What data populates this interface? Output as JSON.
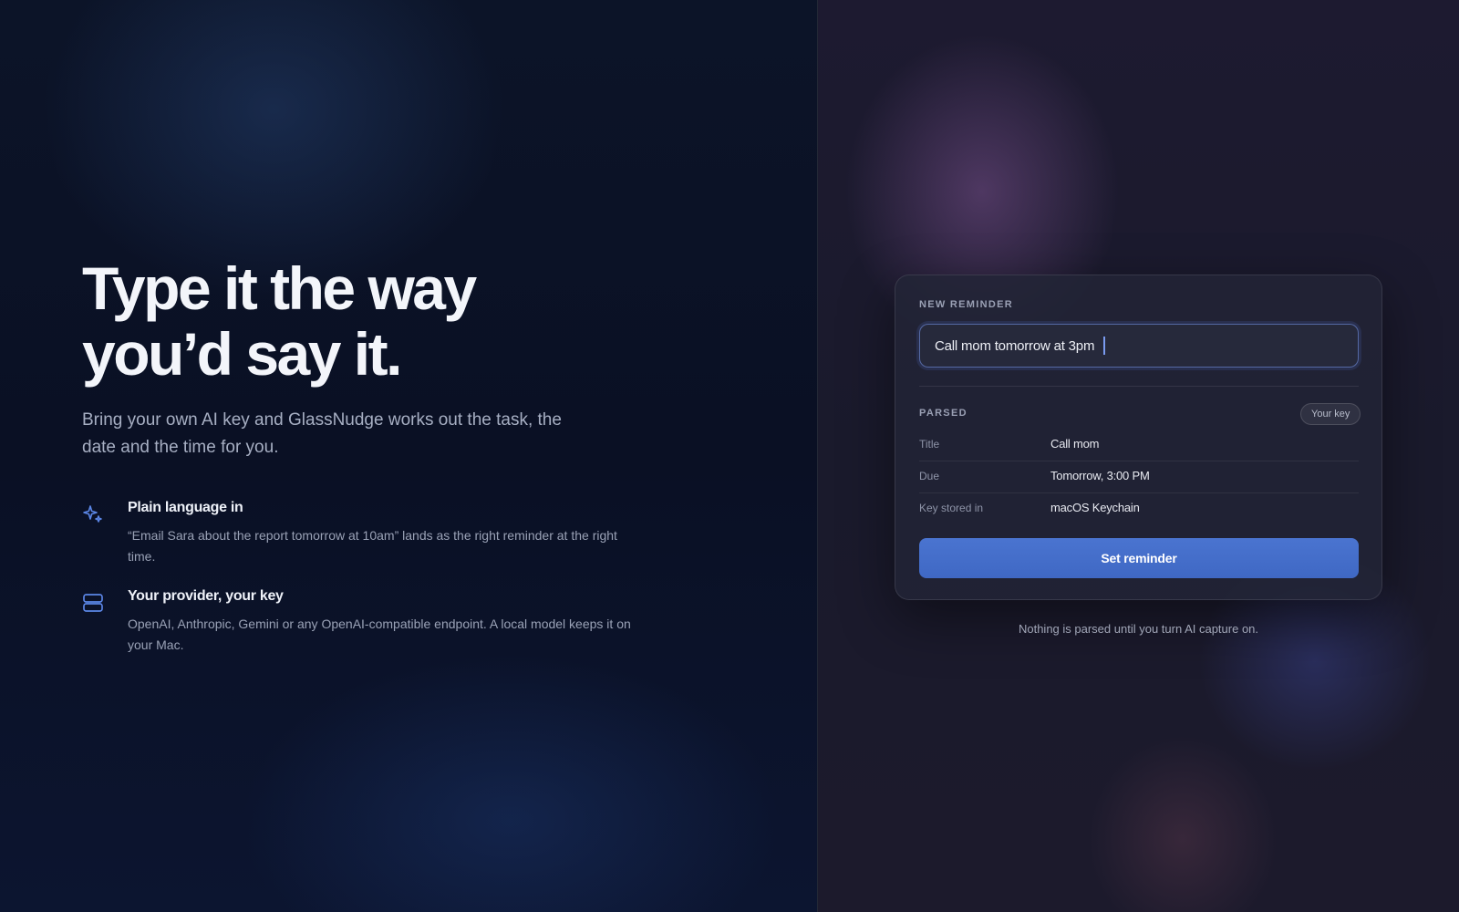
{
  "hero": {
    "headline_line1": "Type it the way",
    "headline_line2": "you’d say it.",
    "subtitle": "Bring your own AI key and GlassNudge works out the task, the date and the time for you."
  },
  "features": [
    {
      "icon": "sparkle-icon",
      "title": "Plain language in",
      "description": "“Email Sara about the report tomorrow at 10am” lands as the right reminder at the right time."
    },
    {
      "icon": "server-icon",
      "title": "Your provider, your key",
      "description": "OpenAI, Anthropic, Gemini or any OpenAI-compatible endpoint. A local model keeps it on your Mac."
    }
  ],
  "card": {
    "section_label": "NEW REMINDER",
    "input_value": "Call mom tomorrow at 3pm",
    "parsed_label": "PARSED",
    "badge": "Your key",
    "rows": [
      {
        "key": "Title",
        "value": "Call mom"
      },
      {
        "key": "Due",
        "value": "Tomorrow, 3:00 PM"
      },
      {
        "key": "Key stored in",
        "value": "macOS Keychain"
      }
    ],
    "button_label": "Set reminder"
  },
  "footnote": "Nothing is parsed until you turn AI capture on.",
  "colors": {
    "accent": "#4a74d0",
    "icon_accent": "#5b86e6"
  }
}
